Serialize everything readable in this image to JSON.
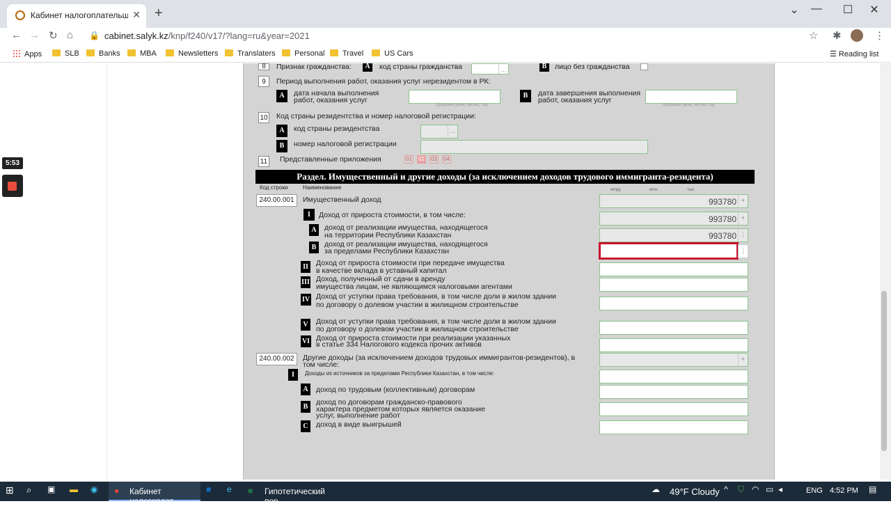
{
  "browser": {
    "tab_title": "Кабинет налогоплательщика - (",
    "url_host": "cabinet.salyk.kz",
    "url_path": "/knp/f240/v17/?lang=ru&year=2021",
    "bookmarks": [
      "Apps",
      "SLB",
      "Banks",
      "MBA",
      "Newsletters",
      "Translaters",
      "Personal",
      "Travel",
      "US Cars"
    ],
    "reading_list": "Reading list"
  },
  "form": {
    "row8": {
      "num": "8",
      "label": "Признак гражданства:",
      "a_label": "код страны гражданства",
      "b_label": "лицо без гражданства"
    },
    "row9": {
      "num": "9",
      "label": "Период выполнения работ, оказания услуг нерезидентом в РК:",
      "a_label_1": "дата начала выполнения",
      "a_label_2": "работ, оказания услуг",
      "b_label_1": "дата завершения выполнения",
      "b_label_2": "работ, оказания услуг",
      "hint": "Цифрами день, месяц, год"
    },
    "row10": {
      "num": "10",
      "label": "Код страны резидентства и номер налоговой регистрации:",
      "a_label": "код страны резидентства",
      "b_label": "номер налоговой регистрации"
    },
    "row11": {
      "num": "11",
      "label": "Представленные приложения",
      "apps": [
        "01",
        "02",
        "03",
        "04"
      ]
    },
    "section_title": "Раздел. Имущественный и другие доходы (за исключением доходов трудового иммигранта-резидента)",
    "col_code": "Код строки",
    "col_name": "Наименование",
    "units": [
      "млрд",
      "млн.",
      "тыс."
    ],
    "lines": {
      "l001_code": "240.00.001",
      "l001_label": "Имущественный доход",
      "l001_value": "993780",
      "i_label": "Доход от прироста стоимости, в том числе:",
      "i_value": "993780",
      "a_label_1": "доход от реализации имущества, находящегося",
      "a_label_2": "на территории Республики Казахстан",
      "a_value": "993780",
      "b_label_1": "доход от реализации имущества, находящегося",
      "b_label_2": "за пределами Республики Казахстан",
      "ii_label_1": "Доход от прироста стоимости при передаче имущества",
      "ii_label_2": "в качестве вклада в уставный капитал",
      "iii_label_1": "Доход, полученный от сдачи в аренду",
      "iii_label_2": "имущества лицам, не являющимся налоговыми агентами",
      "iv_label_1": "Доход от уступки права требования, в том числе доли в жилом здании",
      "iv_label_2": "по договору о долевом участии в жилищном строительстве",
      "v_label_1": "Доход от уступки права требования, в том числе доли в жилом здании",
      "v_label_2": "по договору о долевом участии в жилищном строительстве",
      "vi_label_1": "Доход от прироста стоимости при реализации указанных",
      "vi_label_2": "в статье 334 Налогового кодекса прочих активов",
      "l002_code": "240.00.002",
      "l002_label_1": "Другие доходы (за исключением доходов трудовых иммигрантов-резидентов), в",
      "l002_label_2": "том числе:",
      "l002_i_label": "Доходы из источников за пределами Республики Казахстан, в том числе:",
      "l002_a_label": "доход по трудовым (коллективным) договорам",
      "l002_b_label_1": "доход по договорам гражданско-правового",
      "l002_b_label_2": "характера предметом которых является оказание",
      "l002_b_label_3": "услуг, выполнение работ",
      "l002_c_label": "доход в виде выигрышей"
    }
  },
  "overlay": {
    "timer": "5:53"
  },
  "taskbar": {
    "app1": "Кабинет налогоплат...",
    "app2": "Гипотетический пор...",
    "weather": "49°F  Cloudy",
    "lang": "ENG",
    "time": "4:52 PM"
  }
}
